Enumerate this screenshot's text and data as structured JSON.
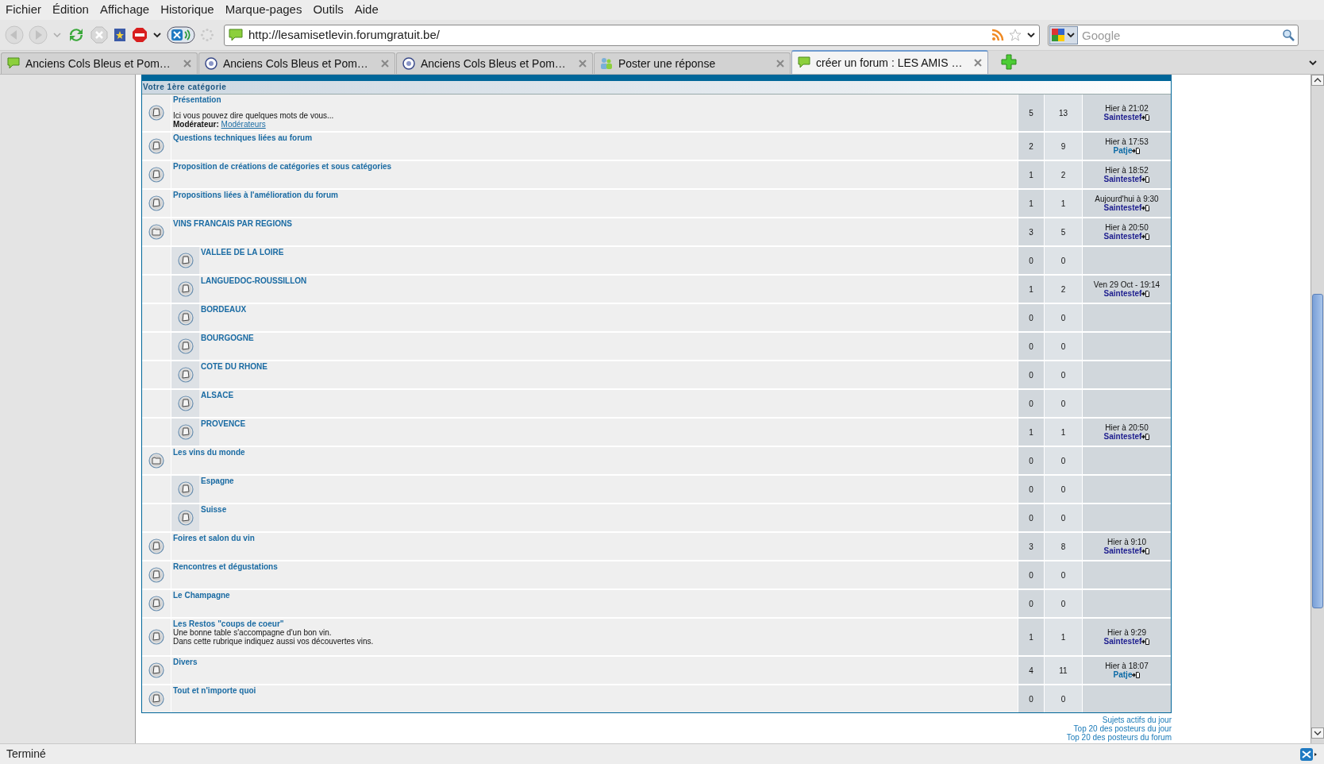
{
  "menu": [
    "Fichier",
    "Édition",
    "Affichage",
    "Historique",
    "Marque-pages",
    "Outils",
    "Aide"
  ],
  "address_bar": {
    "url": "http://lesamisetlevin.forumgratuit.be/"
  },
  "search": {
    "placeholder": "Google"
  },
  "tabs": [
    {
      "label": "Anciens Cols Bleus et Pom…",
      "selected": false,
      "kind": "speech"
    },
    {
      "label": "Anciens Cols Bleus et Pom…",
      "selected": false,
      "kind": "badge"
    },
    {
      "label": "Anciens Cols Bleus et Pom…",
      "selected": false,
      "kind": "badge"
    },
    {
      "label": "Poster une réponse",
      "selected": false,
      "kind": "people"
    },
    {
      "label": "créer un forum : LES AMIS …",
      "selected": true,
      "kind": "speech"
    }
  ],
  "forum": {
    "category": "Votre 1ère catégorie",
    "rows": [
      {
        "kind": "forum",
        "title": "Présentation",
        "description": [
          "Ici vous pouvez dire quelques mots de vous..."
        ],
        "moderator": {
          "label": "**Modérateur:**",
          "link": "Modérateurs"
        },
        "topics": "5",
        "posts": "13",
        "last_post": {
          "date": "Hier à 21:02",
          "author": "Saintestef",
          "color": "#1c1c8e"
        }
      },
      {
        "kind": "forum",
        "title": "Questions techniques liées au forum",
        "topics": "2",
        "posts": "9",
        "last_post": {
          "date": "Hier à 17:53",
          "author": "Patje",
          "color": "#0b6aa6"
        }
      },
      {
        "kind": "forum",
        "title": "Proposition de créations de catégories et sous catégories",
        "topics": "1",
        "posts": "2",
        "last_post": {
          "date": "Hier à 18:52",
          "author": "Saintestef",
          "color": "#1c1c8e"
        }
      },
      {
        "kind": "forum",
        "title": "Propositions liées à l'amélioration du forum",
        "topics": "1",
        "posts": "1",
        "last_post": {
          "date": "Aujourd'hui à 9:30",
          "author": "Saintestef",
          "color": "#1c1c8e"
        }
      },
      {
        "kind": "parent",
        "title": "VINS FRANCAIS PAR REGIONS",
        "topics": "3",
        "posts": "5",
        "last_post": {
          "date": "Hier à 20:50",
          "author": "Saintestef",
          "color": "#1c1c8e"
        },
        "children": [
          {
            "kind": "forum",
            "title": "VALLEE DE LA LOIRE",
            "topics": "0",
            "posts": "0"
          },
          {
            "kind": "forum",
            "title": "LANGUEDOC-ROUSSILLON",
            "topics": "1",
            "posts": "2",
            "last_post": {
              "date": "Ven 29 Oct - 19:14",
              "author": "Saintestef",
              "color": "#1c1c8e"
            }
          },
          {
            "kind": "forum",
            "title": "BORDEAUX",
            "topics": "0",
            "posts": "0"
          },
          {
            "kind": "forum",
            "title": "BOURGOGNE",
            "topics": "0",
            "posts": "0"
          },
          {
            "kind": "forum",
            "title": "COTE DU RHONE",
            "topics": "0",
            "posts": "0"
          },
          {
            "kind": "forum",
            "title": "ALSACE",
            "topics": "0",
            "posts": "0"
          },
          {
            "kind": "forum",
            "title": "PROVENCE",
            "topics": "1",
            "posts": "1",
            "last_post": {
              "date": "Hier à 20:50",
              "author": "Saintestef",
              "color": "#1c1c8e"
            }
          }
        ]
      },
      {
        "kind": "parent",
        "title": "Les vins du monde",
        "topics": "0",
        "posts": "0",
        "children": [
          {
            "kind": "forum",
            "title": "Espagne",
            "topics": "0",
            "posts": "0"
          },
          {
            "kind": "forum",
            "title": "Suisse",
            "topics": "0",
            "posts": "0"
          }
        ]
      },
      {
        "kind": "forum",
        "title": "Foires et salon du vin",
        "topics": "3",
        "posts": "8",
        "last_post": {
          "date": "Hier à 9:10",
          "author": "Saintestef",
          "color": "#1c1c8e"
        }
      },
      {
        "kind": "forum",
        "title": "Rencontres et dégustations",
        "topics": "0",
        "posts": "0"
      },
      {
        "kind": "forum",
        "title": "Le Champagne",
        "topics": "0",
        "posts": "0"
      },
      {
        "kind": "forum",
        "title": "Les Restos \"coups de coeur\"",
        "description": [
          "Une bonne table s'accompagne d'un bon vin.",
          "Dans cette rubrique indiquez aussi vos découvertes vins."
        ],
        "topics": "1",
        "posts": "1",
        "last_post": {
          "date": "Hier à 9:29",
          "author": "Saintestef",
          "color": "#1c1c8e"
        }
      },
      {
        "kind": "forum",
        "title": "Divers",
        "topics": "4",
        "posts": "11",
        "last_post": {
          "date": "Hier à 18:07",
          "author": "Patje",
          "color": "#0b6aa6"
        }
      },
      {
        "kind": "forum",
        "title": "Tout et n'importe quoi",
        "topics": "0",
        "posts": "0"
      }
    ]
  },
  "footer_links": [
    "Sujets actifs du jour",
    "Top 20 des posteurs du jour",
    "Top 20 des posteurs du forum"
  ],
  "status_bar": {
    "text": "Terminé"
  }
}
